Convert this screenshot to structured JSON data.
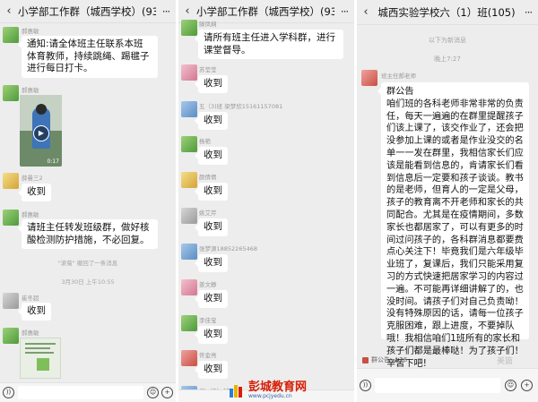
{
  "panels": [
    {
      "title": "小学部工作群（城西学校）(93)",
      "messages": [
        {
          "sender": "郝惠敏",
          "text": "通知:请全体班主任联系本班体育教师，持续跳绳、踢毽子进行每日打卡。"
        },
        {
          "sender": "郝惠敏",
          "video_duration": "0:17"
        },
        {
          "sender": "薛曼三2",
          "text": "收到"
        },
        {
          "sender": "郝惠敏",
          "text": "请班主任转发班级群，做好核酸检测防护措施，不必回复。"
        },
        {
          "system": "\"滚菊\" 撤回了一条消息"
        },
        {
          "time": "3月30日 上午10:55"
        },
        {
          "sender": "崔冬超",
          "text": "收到"
        },
        {
          "sender": "郝惠敏"
        }
      ]
    },
    {
      "title": "小学部工作群（城西学校）(93)",
      "messages": [
        {
          "sender": "滕凤娴",
          "text": "请所有班主任进入学科群，进行课堂督导。"
        },
        {
          "sender": "苏莹莹",
          "text": "收到"
        },
        {
          "sender": "五（3)班 梁梦欣15161157081",
          "text": "收到"
        },
        {
          "sender": "杨艳",
          "text": "收到"
        },
        {
          "sender": "颜倩倩",
          "text": "收到"
        },
        {
          "sender": "姚艾芹",
          "text": "收到"
        },
        {
          "sender": "张梦源18852265468",
          "text": "收到"
        },
        {
          "sender": "姜文静",
          "text": "收到"
        },
        {
          "sender": "李佳宝",
          "text": "收到"
        },
        {
          "sender": "佟金亮",
          "text": "收到"
        },
        {
          "sender": "五（2）班"
        }
      ]
    },
    {
      "title": "城西实验学校六（1）班(105)",
      "new_messages": "以下为新消息",
      "time": "晚上7:27",
      "sender": "班主任郝老师",
      "notice_header": "群公告",
      "notice_body": "咱们班的各科老师非常非常的负责任，每天一遍遍的在群里提醒孩子们该上课了，该交作业了，还会把没参加上课的或者是作业没交的名单一一发在群里，我相信家长们应该是能看到信息的，肯请家长们看到信息后一定要和孩子谈谈。教书的是老师，但育人的一定是父母，孩子的教育离不开老师和家长的共同配合。尤其是在疫情期间，多数家长也都居家了，可以有更多的时间过问孩子的，各科群消息都要费点心关注下！毕竟我们是六年级毕业班了，复课后，我们只能采用复习的方式快速把居家学习的内容过一遍。不可能再详细讲解了的，也没时间。请孩子们对自己负责呦！没有特殊原因的话，请每一位孩子克服困难，跟上进度，不要掉队哦！我相信咱们1班所有的家长和孩子们都是最棒哒！为了孩子们！辛苦下吧!",
      "pinned": "群公告",
      "pinned_count": "26"
    }
  ],
  "watermark": {
    "name": "彭城教育网",
    "url": "www.pcjyedu.cn"
  },
  "corner_logo": "美篇",
  "colors": {
    "chat_bg": "#ededed",
    "bubble": "#ffffff",
    "brand_red": "#d81e06"
  }
}
